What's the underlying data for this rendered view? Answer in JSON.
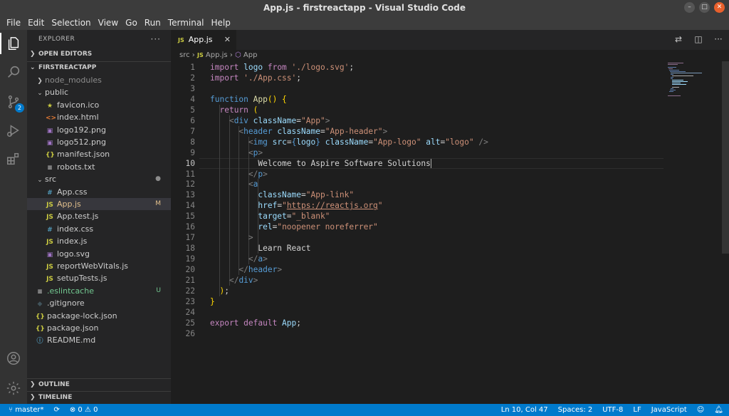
{
  "window": {
    "title": "App.js - firstreactapp - Visual Studio Code"
  },
  "menu": [
    "File",
    "Edit",
    "Selection",
    "View",
    "Go",
    "Run",
    "Terminal",
    "Help"
  ],
  "activity": {
    "scm_badge": "2"
  },
  "sidebar": {
    "title": "EXPLORER",
    "open_editors": "OPEN EDITORS",
    "project": "FIRSTREACTAPP",
    "outline": "OUTLINE",
    "timeline": "TIMELINE",
    "tree": [
      {
        "label": "node_modules",
        "icon": "chevron-right",
        "indent": 1,
        "kind": "folder",
        "color": "#8c8c8c"
      },
      {
        "label": "public",
        "icon": "chevron-down",
        "indent": 1,
        "kind": "folder",
        "color": "#cccccc"
      },
      {
        "label": "favicon.ico",
        "icon": "star",
        "indent": 2,
        "kind": "file",
        "glyph": "★",
        "gcolor": "#cbcb41"
      },
      {
        "label": "index.html",
        "icon": "html",
        "indent": 2,
        "kind": "file",
        "glyph": "<>",
        "gcolor": "#e37933"
      },
      {
        "label": "logo192.png",
        "icon": "image",
        "indent": 2,
        "kind": "file",
        "glyph": "▣",
        "gcolor": "#a074c4"
      },
      {
        "label": "logo512.png",
        "icon": "image",
        "indent": 2,
        "kind": "file",
        "glyph": "▣",
        "gcolor": "#a074c4"
      },
      {
        "label": "manifest.json",
        "icon": "json",
        "indent": 2,
        "kind": "file",
        "glyph": "{}",
        "gcolor": "#cbcb41"
      },
      {
        "label": "robots.txt",
        "icon": "text",
        "indent": 2,
        "kind": "file",
        "glyph": "≡",
        "gcolor": "#c5c5c5"
      },
      {
        "label": "src",
        "icon": "chevron-down",
        "indent": 1,
        "kind": "folder",
        "color": "#cccccc",
        "right": "●",
        "rcolor": "#8c8c8c"
      },
      {
        "label": "App.css",
        "icon": "css",
        "indent": 2,
        "kind": "file",
        "glyph": "#",
        "gcolor": "#519aba"
      },
      {
        "label": "App.js",
        "icon": "js",
        "indent": 2,
        "kind": "file",
        "glyph": "JS",
        "gcolor": "#cbcb41",
        "right": "M",
        "rcolor": "#e2c08d",
        "selected": true,
        "color": "#e2c08d"
      },
      {
        "label": "App.test.js",
        "icon": "js",
        "indent": 2,
        "kind": "file",
        "glyph": "JS",
        "gcolor": "#cbcb41"
      },
      {
        "label": "index.css",
        "icon": "css",
        "indent": 2,
        "kind": "file",
        "glyph": "#",
        "gcolor": "#519aba"
      },
      {
        "label": "index.js",
        "icon": "js",
        "indent": 2,
        "kind": "file",
        "glyph": "JS",
        "gcolor": "#cbcb41"
      },
      {
        "label": "logo.svg",
        "icon": "image",
        "indent": 2,
        "kind": "file",
        "glyph": "▣",
        "gcolor": "#a074c4"
      },
      {
        "label": "reportWebVitals.js",
        "icon": "js",
        "indent": 2,
        "kind": "file",
        "glyph": "JS",
        "gcolor": "#cbcb41"
      },
      {
        "label": "setupTests.js",
        "icon": "js",
        "indent": 2,
        "kind": "file",
        "glyph": "JS",
        "gcolor": "#cbcb41"
      },
      {
        "label": ".eslintcache",
        "icon": "text",
        "indent": 1,
        "kind": "file",
        "glyph": "≡",
        "gcolor": "#c5c5c5",
        "right": "U",
        "rcolor": "#73c991",
        "color": "#73c991"
      },
      {
        "label": ".gitignore",
        "icon": "git",
        "indent": 1,
        "kind": "file",
        "glyph": "◆",
        "gcolor": "#41535b"
      },
      {
        "label": "package-lock.json",
        "icon": "json",
        "indent": 1,
        "kind": "file",
        "glyph": "{}",
        "gcolor": "#cbcb41"
      },
      {
        "label": "package.json",
        "icon": "json",
        "indent": 1,
        "kind": "file",
        "glyph": "{}",
        "gcolor": "#cbcb41"
      },
      {
        "label": "README.md",
        "icon": "info",
        "indent": 1,
        "kind": "file",
        "glyph": "ⓘ",
        "gcolor": "#519aba"
      }
    ]
  },
  "editor": {
    "tab_label": "App.js",
    "tab_icon": "JS",
    "breadcrumb": {
      "folder": "src",
      "file": "App.js",
      "symbol": "App"
    },
    "current_line": 10,
    "lines": [
      [
        [
          "kw",
          "import "
        ],
        [
          "var",
          "logo "
        ],
        [
          "kw",
          "from "
        ],
        [
          "str",
          "'./logo.svg'"
        ],
        [
          "txt",
          ";"
        ]
      ],
      [
        [
          "kw",
          "import "
        ],
        [
          "str",
          "'./App.css'"
        ],
        [
          "txt",
          ";"
        ]
      ],
      [],
      [
        [
          "kw2",
          "function "
        ],
        [
          "fn",
          "App"
        ],
        [
          "br",
          "() {"
        ]
      ],
      [
        [
          "txt",
          "  "
        ],
        [
          "kw",
          "return "
        ],
        [
          "br",
          "("
        ]
      ],
      [
        [
          "txt",
          "    "
        ],
        [
          "pun",
          "<"
        ],
        [
          "tag",
          "div "
        ],
        [
          "attr",
          "className"
        ],
        [
          "txt",
          "="
        ],
        [
          "str",
          "\"App\""
        ],
        [
          "pun",
          ">"
        ]
      ],
      [
        [
          "txt",
          "      "
        ],
        [
          "pun",
          "<"
        ],
        [
          "tag",
          "header "
        ],
        [
          "attr",
          "className"
        ],
        [
          "txt",
          "="
        ],
        [
          "str",
          "\"App-header\""
        ],
        [
          "pun",
          ">"
        ]
      ],
      [
        [
          "txt",
          "        "
        ],
        [
          "pun",
          "<"
        ],
        [
          "tag",
          "img "
        ],
        [
          "attr",
          "src"
        ],
        [
          "txt",
          "="
        ],
        [
          "kw2",
          "{"
        ],
        [
          "var",
          "logo"
        ],
        [
          "kw2",
          "} "
        ],
        [
          "attr",
          "className"
        ],
        [
          "txt",
          "="
        ],
        [
          "str",
          "\"App-logo\" "
        ],
        [
          "attr",
          "alt"
        ],
        [
          "txt",
          "="
        ],
        [
          "str",
          "\"logo\" "
        ],
        [
          "pun",
          "/>"
        ]
      ],
      [
        [
          "txt",
          "        "
        ],
        [
          "pun",
          "<"
        ],
        [
          "tag",
          "p"
        ],
        [
          "pun",
          ">"
        ]
      ],
      [
        [
          "txt",
          "          Welcome to Aspire Software Solutions"
        ],
        [
          "cursor",
          ""
        ]
      ],
      [
        [
          "txt",
          "        "
        ],
        [
          "pun",
          "</"
        ],
        [
          "tag",
          "p"
        ],
        [
          "pun",
          ">"
        ]
      ],
      [
        [
          "txt",
          "        "
        ],
        [
          "pun",
          "<"
        ],
        [
          "tag",
          "a"
        ]
      ],
      [
        [
          "txt",
          "          "
        ],
        [
          "attr",
          "className"
        ],
        [
          "txt",
          "="
        ],
        [
          "str",
          "\"App-link\""
        ]
      ],
      [
        [
          "txt",
          "          "
        ],
        [
          "attr",
          "href"
        ],
        [
          "txt",
          "="
        ],
        [
          "str",
          "\""
        ],
        [
          "url",
          "https://reactjs.org"
        ],
        [
          "str",
          "\""
        ]
      ],
      [
        [
          "txt",
          "          "
        ],
        [
          "attr",
          "target"
        ],
        [
          "txt",
          "="
        ],
        [
          "str",
          "\"_blank\""
        ]
      ],
      [
        [
          "txt",
          "          "
        ],
        [
          "attr",
          "rel"
        ],
        [
          "txt",
          "="
        ],
        [
          "str",
          "\"noopener noreferrer\""
        ]
      ],
      [
        [
          "txt",
          "        "
        ],
        [
          "pun",
          ">"
        ]
      ],
      [
        [
          "txt",
          "          Learn React"
        ]
      ],
      [
        [
          "txt",
          "        "
        ],
        [
          "pun",
          "</"
        ],
        [
          "tag",
          "a"
        ],
        [
          "pun",
          ">"
        ]
      ],
      [
        [
          "txt",
          "      "
        ],
        [
          "pun",
          "</"
        ],
        [
          "tag",
          "header"
        ],
        [
          "pun",
          ">"
        ]
      ],
      [
        [
          "txt",
          "    "
        ],
        [
          "pun",
          "</"
        ],
        [
          "tag",
          "div"
        ],
        [
          "pun",
          ">"
        ]
      ],
      [
        [
          "txt",
          "  "
        ],
        [
          "br",
          ")"
        ],
        [
          "txt",
          ";"
        ]
      ],
      [
        [
          "br",
          "}"
        ]
      ],
      [],
      [
        [
          "kw",
          "export "
        ],
        [
          "kw",
          "default "
        ],
        [
          "var",
          "App"
        ],
        [
          "txt",
          ";"
        ]
      ],
      []
    ]
  },
  "status": {
    "branch": "master*",
    "sync": "⟳",
    "errors": "0",
    "warnings": "0",
    "position": "Ln 10, Col 47",
    "spaces": "Spaces: 2",
    "encoding": "UTF-8",
    "eol": "LF",
    "language": "JavaScript"
  }
}
